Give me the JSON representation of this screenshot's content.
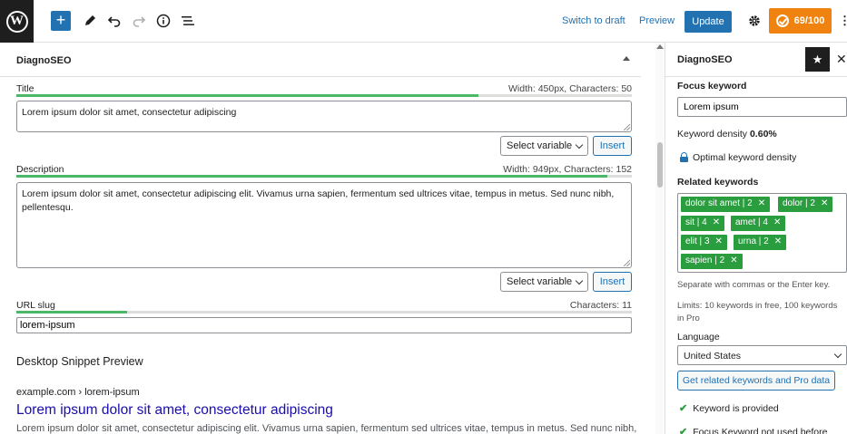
{
  "toolbar": {
    "logo_label": "W",
    "add_label": "+",
    "switch_draft_label": "Switch to draft",
    "preview_label": "Preview",
    "update_label": "Update",
    "score_label": "69/100",
    "more_label": "⋮"
  },
  "panel": {
    "title": "DiagnoSEO",
    "title_field": {
      "label": "Title",
      "meta": "Width: 450px, Characters: 50",
      "value": "Lorem ipsum dolor sit amet, consectetur adipiscing",
      "progress": 0.75
    },
    "description_field": {
      "label": "Description",
      "meta": "Width: 949px, Characters: 152",
      "value": "Lorem ipsum dolor sit amet, consectetur adipiscing elit. Vivamus urna sapien, fermentum sed ultrices vitae, tempus in metus. Sed nunc nibh, pellentesqu.",
      "progress": 0.96
    },
    "select_variable_label": "Select variable",
    "insert_label": "Insert",
    "url_slug": {
      "label": "URL slug",
      "meta": "Characters: 11",
      "value": "lorem-ipsum",
      "progress": 0.18
    },
    "snippet": {
      "heading": "Desktop Snippet Preview",
      "url": "example.com › lorem-ipsum",
      "title": "Lorem ipsum dolor sit amet, consectetur adipiscing",
      "description": "Lorem ipsum dolor sit amet, consectetur adipiscing elit. Vivamus urna sapien, fermentum sed ultrices vitae, tempus in metus. Sed nunc nibh,"
    }
  },
  "sidebar": {
    "title": "DiagnoSEO",
    "star_label": "★",
    "close_label": "✕",
    "focus_keyword_label": "Focus keyword",
    "focus_keyword_value": "Lorem ipsum",
    "density_label": "Keyword density",
    "density_value": "0.60%",
    "optimal_label": "Optimal keyword density",
    "related_label": "Related keywords",
    "chips": [
      {
        "label": "dolor sit amet | 2"
      },
      {
        "label": "dolor | 2"
      },
      {
        "label": "sit | 4"
      },
      {
        "label": "amet | 4"
      },
      {
        "label": "elit | 3"
      },
      {
        "label": "urna | 2"
      },
      {
        "label": "sapien | 2"
      }
    ],
    "chip_remove": "✕",
    "separate_hint": "Separate with commas or the Enter key.",
    "limits_line1": "Limits: 10 keywords in free, 100 keywords",
    "limits_line2": "in Pro",
    "language_label": "Language",
    "language_value": "United States",
    "related_button": "Get related keywords and Pro data",
    "checks": [
      {
        "label": "Keyword is provided"
      },
      {
        "label": "Focus Keyword not used before"
      }
    ],
    "check_mark": "✔"
  },
  "colors": {
    "accent": "#2271b1",
    "score": "#f0820f",
    "chip": "#2a9d3f",
    "progress": "#4ab866",
    "link": "#1a0dab"
  }
}
